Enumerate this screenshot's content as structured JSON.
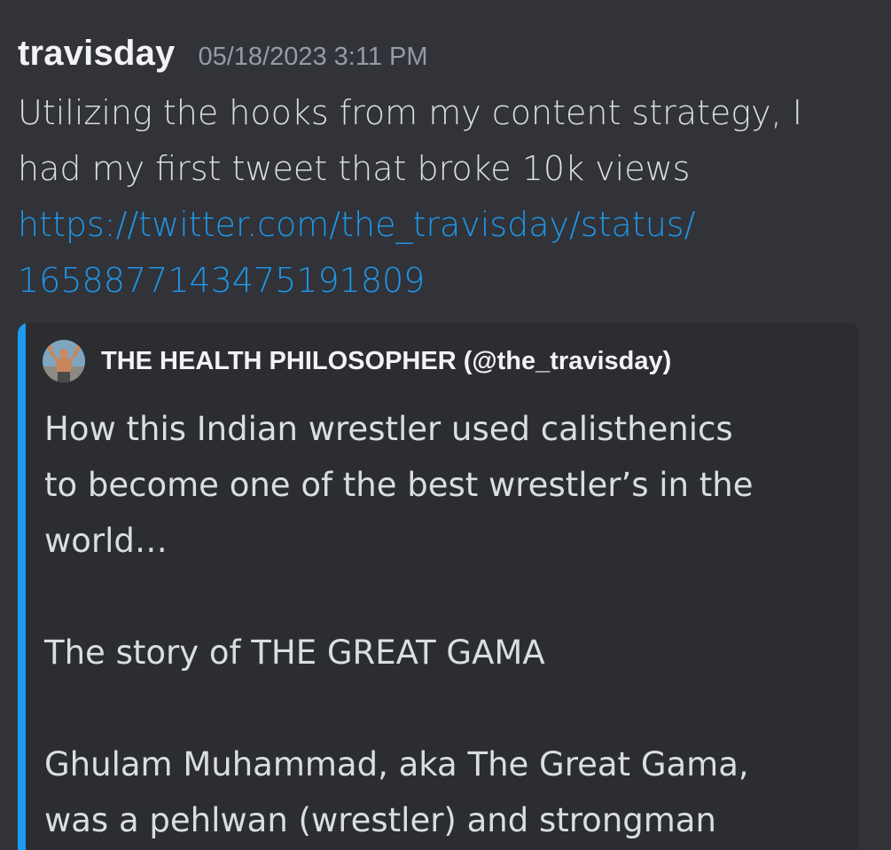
{
  "message": {
    "username": "travisday",
    "timestamp": "05/18/2023 3:11 PM",
    "text_lines": [
      "Utilizing the hooks from my content strategy, I",
      "had my first tweet that broke 10k views"
    ],
    "link_lines": [
      "https://twitter.com/the_travisday/status/",
      "1658877143475191809"
    ]
  },
  "embed": {
    "accent_color": "#1d9bf0",
    "author": "THE HEALTH PHILOSOPHER (@the_travisday)",
    "description_lines": [
      "How this Indian wrestler used calisthenics",
      "to become one of the best wrestler’s in the",
      "world…",
      "",
      "The story of THE GREAT GAMA",
      "",
      "Ghulam Muhammad, aka The Great Gama,",
      "was a pehlwan (wrestler) and strongman"
    ]
  },
  "colors": {
    "background": "#313338",
    "embed_background": "#2b2d31",
    "link": "#1e96e8",
    "text": "#dbdee1",
    "muted": "#949ba4"
  }
}
